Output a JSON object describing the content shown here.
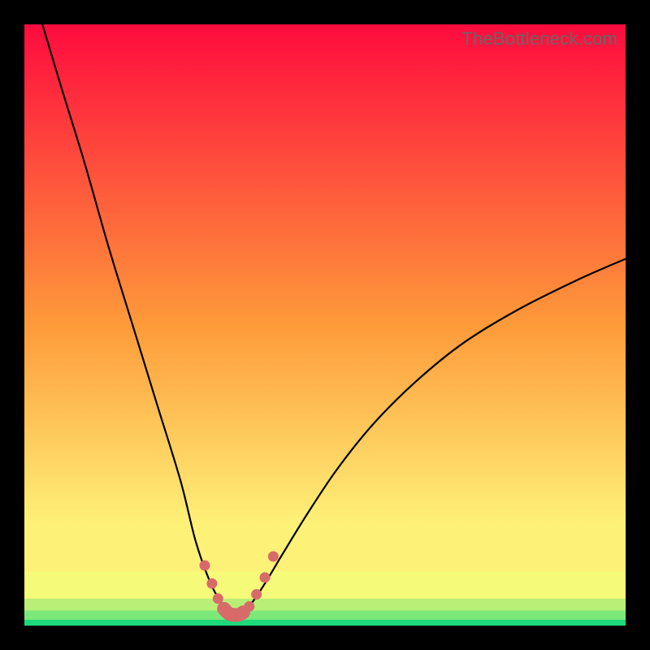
{
  "watermark": "TheBottleneck.com",
  "chart_data": {
    "type": "line",
    "title": "",
    "xlabel": "",
    "ylabel": "",
    "xlim": [
      0,
      1
    ],
    "ylim": [
      0,
      1
    ],
    "curve": {
      "x": [
        0.03,
        0.06,
        0.1,
        0.14,
        0.18,
        0.22,
        0.26,
        0.285,
        0.31,
        0.33,
        0.345,
        0.355,
        0.365,
        0.38,
        0.4,
        0.43,
        0.47,
        0.52,
        0.58,
        0.65,
        0.73,
        0.82,
        0.92,
        1.0
      ],
      "y": [
        1.0,
        0.9,
        0.77,
        0.63,
        0.5,
        0.37,
        0.24,
        0.14,
        0.07,
        0.035,
        0.02,
        0.018,
        0.022,
        0.04,
        0.07,
        0.12,
        0.185,
        0.26,
        0.335,
        0.405,
        0.47,
        0.525,
        0.575,
        0.61
      ]
    },
    "dotted_segment": {
      "x": [
        0.3,
        0.312,
        0.322,
        0.332,
        0.34,
        0.348,
        0.356,
        0.364,
        0.374,
        0.386,
        0.4,
        0.414
      ],
      "y": [
        0.1,
        0.07,
        0.045,
        0.028,
        0.02,
        0.018,
        0.018,
        0.022,
        0.032,
        0.052,
        0.08,
        0.115
      ],
      "color": "#d86a6a",
      "dot_radius": 6.5,
      "pill_indices": [
        [
          3,
          7
        ]
      ]
    },
    "background_bands": [
      {
        "y0": 0.0,
        "y1": 0.01,
        "color": "#1ed97a"
      },
      {
        "y0": 0.01,
        "y1": 0.025,
        "color": "#7be87a"
      },
      {
        "y0": 0.025,
        "y1": 0.045,
        "color": "#b9ef76"
      },
      {
        "y0": 0.045,
        "y1": 0.09,
        "color": "#f5fa78"
      },
      {
        "y0": 0.09,
        "y1": 0.17,
        "color": "#fef178"
      }
    ],
    "gradient_stops": [
      {
        "offset": 0.0,
        "color": "#ff0b3e"
      },
      {
        "offset": 0.5,
        "color": "#fe9a3a"
      },
      {
        "offset": 0.83,
        "color": "#fef178"
      },
      {
        "offset": 1.0,
        "color": "#fef178"
      }
    ]
  }
}
